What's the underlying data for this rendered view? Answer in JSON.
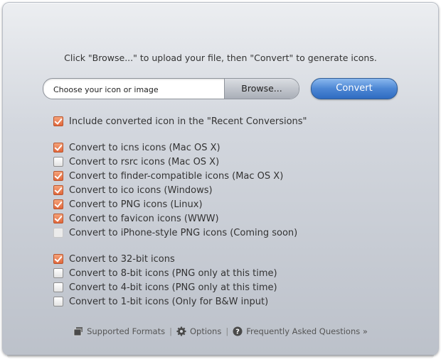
{
  "instructions": "Click \"Browse...\" to upload your file, then \"Convert\" to generate icons.",
  "file_input": {
    "placeholder": "Choose your icon or image",
    "browse_label": "Browse..."
  },
  "convert_label": "Convert",
  "options": [
    {
      "label": "Include converted icon in the \"Recent Conversions\"",
      "checked": true,
      "disabled": false
    },
    {
      "label": "Convert to icns icons (Mac OS X)",
      "checked": true,
      "disabled": false
    },
    {
      "label": "Convert to rsrc icons (Mac OS X)",
      "checked": false,
      "disabled": false
    },
    {
      "label": "Convert to finder-compatible icons (Mac OS X)",
      "checked": true,
      "disabled": false
    },
    {
      "label": "Convert to ico icons (Windows)",
      "checked": true,
      "disabled": false
    },
    {
      "label": "Convert to PNG icons (Linux)",
      "checked": true,
      "disabled": false
    },
    {
      "label": "Convert to favicon icons (WWW)",
      "checked": true,
      "disabled": false
    },
    {
      "label": "Convert to iPhone-style PNG icons (Coming soon)",
      "checked": false,
      "disabled": true
    },
    {
      "label": "Convert to 32-bit icons",
      "checked": true,
      "disabled": false
    },
    {
      "label": "Convert to 8-bit icons (PNG only at this time)",
      "checked": false,
      "disabled": false
    },
    {
      "label": "Convert to 4-bit icons (PNG only at this time)",
      "checked": false,
      "disabled": false
    },
    {
      "label": "Convert to 1-bit icons (Only for B&W input)",
      "checked": false,
      "disabled": false
    }
  ],
  "footer": {
    "supported_formats": "Supported Formats",
    "options": "Options",
    "faq": "Frequently Asked Questions »",
    "separator": "|"
  },
  "colors": {
    "convert_button": "#4c86d4",
    "checkbox_checked": "#e1663a"
  }
}
